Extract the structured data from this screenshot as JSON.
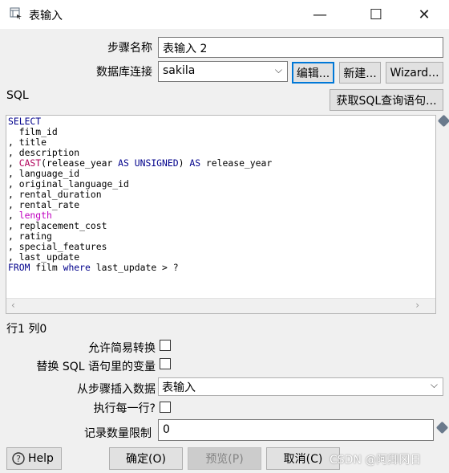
{
  "window": {
    "title": "表输入",
    "minimize_glyph": "—",
    "maximize_glyph": "☐",
    "close_glyph": "✕",
    "icon": "table-input-icon"
  },
  "form": {
    "step_name_label": "步骤名称",
    "step_name_value": "表输入 2",
    "db_connection_label": "数据库连接",
    "db_connection_value": "sakila",
    "edit_button": "编辑...",
    "new_button": "新建...",
    "wizard_button": "Wizard...",
    "sql_label": "SQL",
    "get_sql_button": "获取SQL查询语句...",
    "sql_lines": [
      "SELECT",
      "  film_id",
      ", title",
      ", description",
      ", CAST(release_year AS UNSIGNED) AS release_year",
      ", language_id",
      ", original_language_id",
      ", rental_duration",
      ", rental_rate",
      ", length",
      ", replacement_cost",
      ", rating",
      ", special_features",
      ", last_update",
      "FROM film where last_update > ?"
    ],
    "cursor_position": "行1 列0",
    "lazy_conversion_label": "允许简易转换",
    "replace_vars_label": "替换 SQL 语句里的变量",
    "insert_from_step_label": "从步骤插入数据",
    "insert_from_step_value": "表输入",
    "execute_each_row_label": "执行每一行?",
    "limit_label": "记录数量限制",
    "limit_value": "0"
  },
  "footer": {
    "help_button": "Help",
    "ok_button": "确定(O)",
    "preview_button": "预览(P)",
    "cancel_button": "取消(C)",
    "watermark": "CSDN @阿卿冈日"
  },
  "colors": {
    "focus_border": "#0078d7",
    "keyword": "#00008b",
    "function": "#b0005a"
  }
}
